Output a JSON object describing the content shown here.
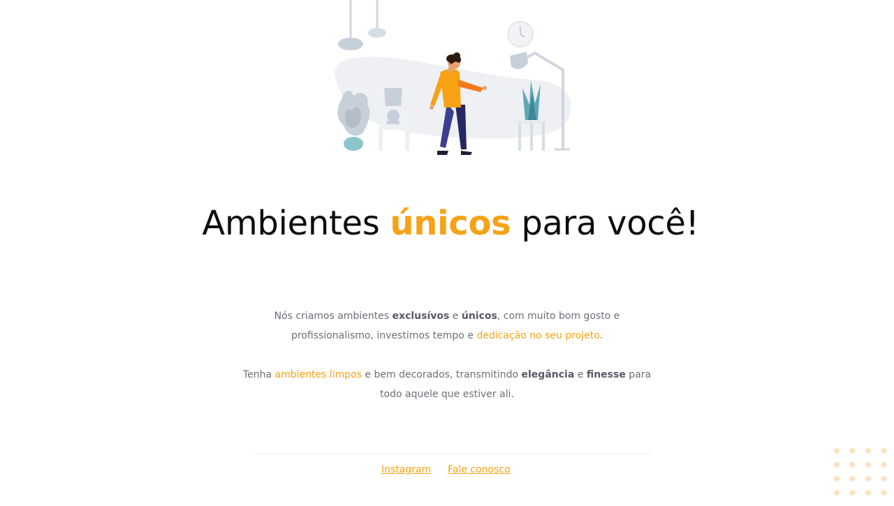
{
  "hero": {
    "title_before": "Ambientes ",
    "title_accent": "únicos",
    "title_after": " para você!"
  },
  "intro": {
    "p1": [
      {
        "t": "Nós criamos ambientes ",
        "s": "text"
      },
      {
        "t": "exclusívos",
        "s": "bold"
      },
      {
        "t": " e ",
        "s": "text"
      },
      {
        "t": "únicos",
        "s": "bold"
      },
      {
        "t": ", com muito bom gosto e profissionalismo, investimos tempo e ",
        "s": "text"
      },
      {
        "t": "dedicação no seu projeto",
        "s": "highlight"
      },
      {
        "t": ".",
        "s": "text"
      }
    ],
    "p2": [
      {
        "t": "Tenha ",
        "s": "text"
      },
      {
        "t": "ambientes limpos",
        "s": "highlight"
      },
      {
        "t": " e bem decorados, transmitindo ",
        "s": "text"
      },
      {
        "t": "elegância",
        "s": "bold"
      },
      {
        "t": "  e ",
        "s": "text"
      },
      {
        "t": "finesse",
        "s": "bold"
      },
      {
        "t": " para todo aquele que estiver ali.",
        "s": "text"
      }
    ]
  },
  "footer": {
    "links": [
      "Instagram",
      "Fale conosco"
    ]
  },
  "colors": {
    "accent": "#f7a214",
    "text": "#6f6d78",
    "heading": "#0d0d0d"
  },
  "icons": {
    "illustration": "person-in-living-room-illustration",
    "decoration": "dot-grid-decoration"
  }
}
